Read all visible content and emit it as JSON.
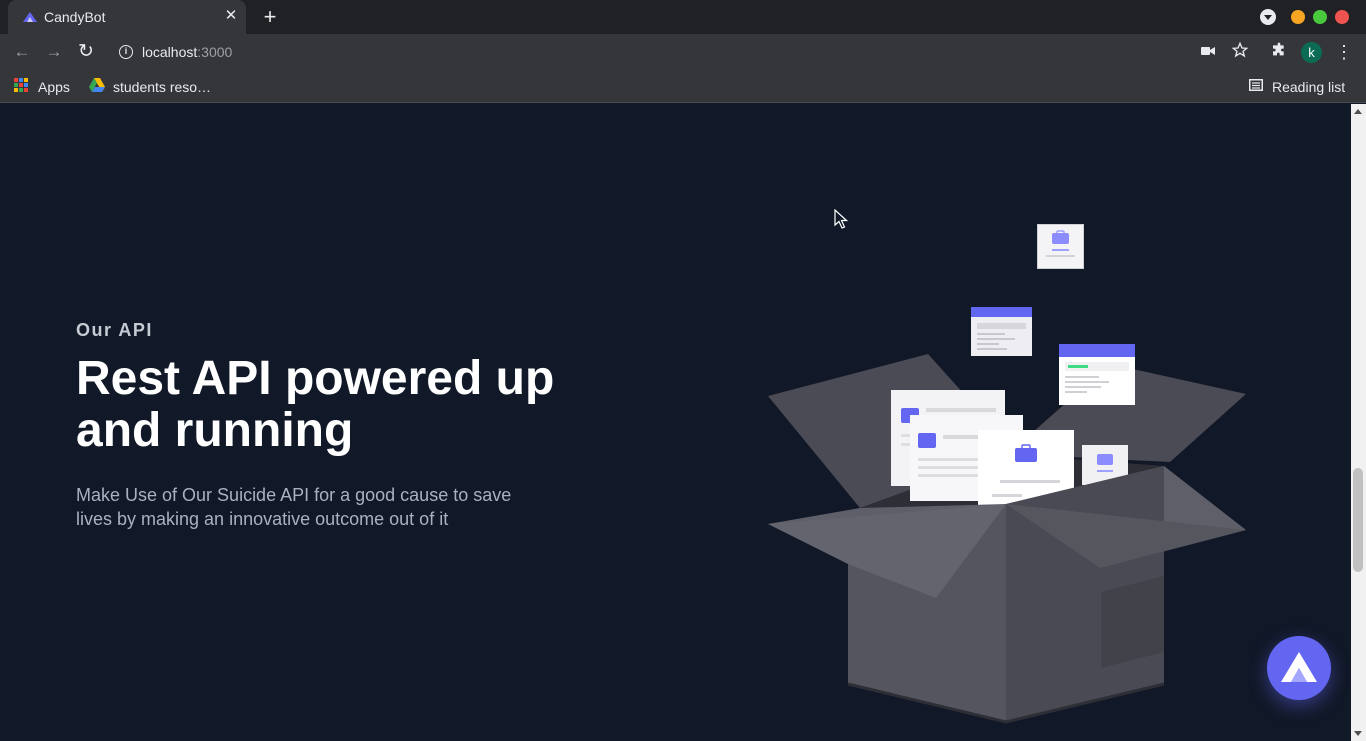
{
  "browser": {
    "tab": {
      "title": "CandyBot",
      "close_glyph": "✕"
    },
    "new_tab_glyph": "+",
    "window_controls": {
      "minimize_color": "#f6a623",
      "maximize_color": "#4ac93f",
      "close_color": "#ef5350"
    },
    "nav": {
      "back_glyph": "←",
      "forward_glyph": "→",
      "reload_glyph": "↻"
    },
    "address": {
      "host": "localhost",
      "port": ":3000",
      "info_glyph": "i"
    },
    "toolbar_icons": [
      "camera-icon",
      "star-icon",
      "extensions-icon"
    ],
    "profile_initial": "k",
    "menu_glyph": "⋮",
    "bookmarks": [
      {
        "label": "Apps",
        "icon": "apps-grid-icon"
      },
      {
        "label": "students reso…",
        "icon": "google-drive-icon"
      }
    ],
    "reading_list": {
      "label": "Reading list",
      "icon": "reading-list-icon"
    }
  },
  "hero": {
    "eyebrow": "Our API",
    "headline": "Rest API powered up and running",
    "lead": "Make Use of Our Suicide API for a good cause to save lives by making an innovative outcome out of it"
  },
  "colors": {
    "page_background": "#111827",
    "accent": "#6366f1",
    "box_light": "#5a5a66",
    "box_dark": "#45454f"
  },
  "fab": {
    "icon": "app-logo-icon"
  }
}
